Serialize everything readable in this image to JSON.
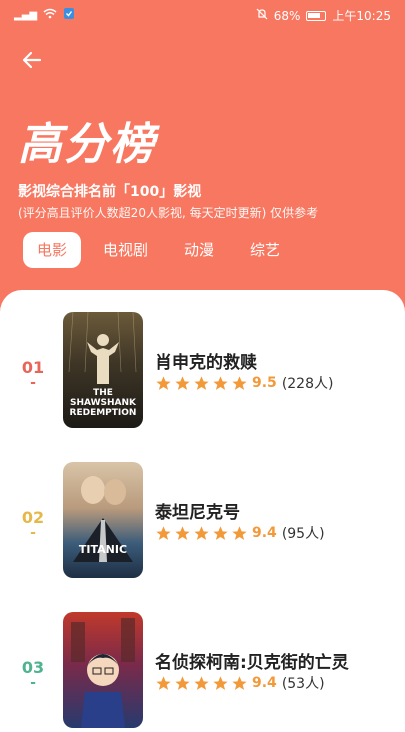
{
  "status_bar": {
    "signal_text": "⁴⁶",
    "battery": "68%",
    "time": "上午10:25"
  },
  "header": {
    "back_icon": "arrow-left-icon",
    "title": "高分榜",
    "subtitle": "影视综合排名前「100」影视",
    "note": "(评分高且评价人数超20人影视, 每天定时更新) 仅供参考"
  },
  "tabs": [
    {
      "label": "电影",
      "active": true
    },
    {
      "label": "电视剧",
      "active": false
    },
    {
      "label": "动漫",
      "active": false
    },
    {
      "label": "综艺",
      "active": false
    }
  ],
  "colors": {
    "accent": "#f87760",
    "star": "#f29a3a",
    "rank1": "#e8655a",
    "rank2": "#e6b84a",
    "rank3": "#4fb38f"
  },
  "list": [
    {
      "rank": "01",
      "title": "肖申克的救赎",
      "score": "9.5",
      "votes": "(228人)",
      "stars": 5,
      "poster_caption": "THE SHAWSHANK REDEMPTION"
    },
    {
      "rank": "02",
      "title": "泰坦尼克号",
      "score": "9.4",
      "votes": "(95人)",
      "stars": 5,
      "poster_caption": "TITANIC"
    },
    {
      "rank": "03",
      "title": "名侦探柯南:贝克街的亡灵",
      "score": "9.4",
      "votes": "(53人)",
      "stars": 5,
      "poster_caption": ""
    }
  ]
}
